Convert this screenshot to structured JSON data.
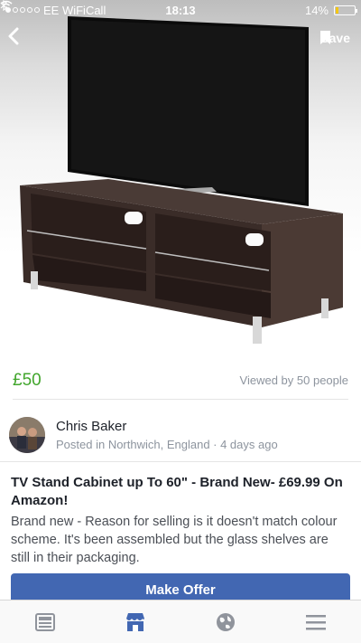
{
  "status_bar": {
    "carrier": "EE WiFiCall",
    "time": "18:13",
    "battery": "14%",
    "battery_level": 0.14,
    "signal_bars_filled": 1,
    "signal_bars_total": 5
  },
  "header": {
    "save_label": "Save",
    "back_icon": "chevron-left-icon",
    "save_icon": "bookmark-icon"
  },
  "listing": {
    "price": "£50",
    "viewed": "Viewed by 50 people",
    "seller_name": "Chris Baker",
    "seller_meta": "Posted in Northwich, England · 4 days ago",
    "title": "TV Stand Cabinet up To 60\" - Brand New- £69.99 On Amazon!",
    "description": "Brand new - Reason for selling is it doesn't match colour scheme. It's been assembled but the glass shelves are still in their packaging.",
    "cta": "Make Offer"
  },
  "tabs": [
    {
      "icon": "news-feed-icon",
      "active": false
    },
    {
      "icon": "marketplace-icon",
      "active": true
    },
    {
      "icon": "globe-icon",
      "active": false
    },
    {
      "icon": "menu-icon",
      "active": false
    }
  ],
  "colors": {
    "price": "#42a62d",
    "accent": "#4267b2",
    "muted": "#8d949e"
  }
}
